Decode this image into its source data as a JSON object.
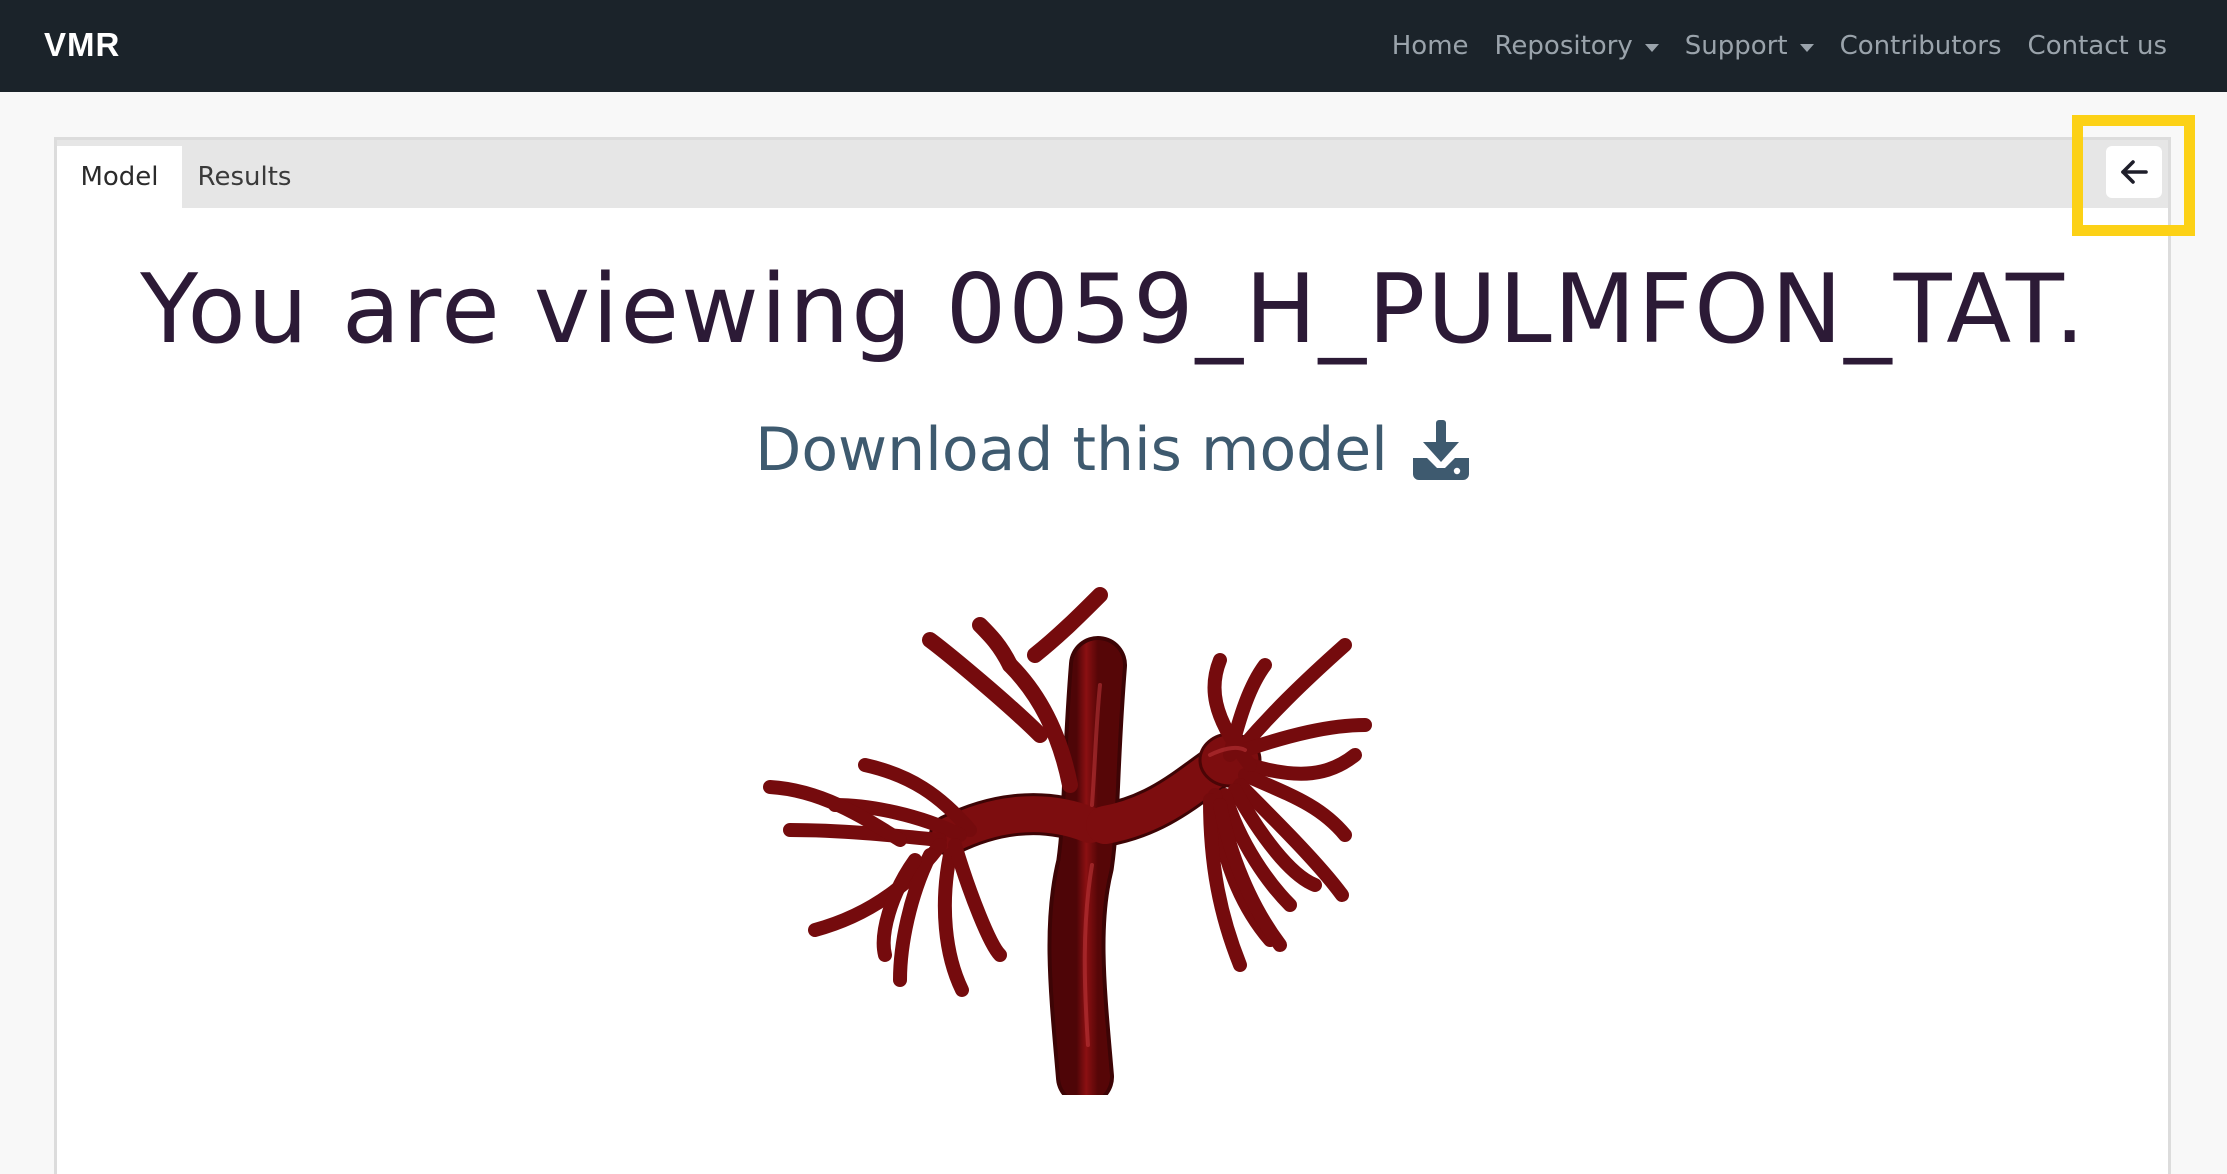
{
  "navbar": {
    "brand": "VMR",
    "links": [
      "Home",
      "Repository",
      "Support",
      "Contributors",
      "Contact us"
    ]
  },
  "tabs": [
    "Model",
    "Results"
  ],
  "main": {
    "title": "You are viewing 0059_H_PULMFON_TAT.",
    "download_label": "Download this model"
  },
  "icons": {
    "back": "arrow-left-icon",
    "download": "download-icon",
    "model": "pulmonary-artery-model"
  },
  "colors": {
    "navbar": "#1b232a",
    "title": "#2c1a36",
    "download": "#3e5a6f",
    "model": "#7a0c0e",
    "highlight": "#fcd116"
  }
}
